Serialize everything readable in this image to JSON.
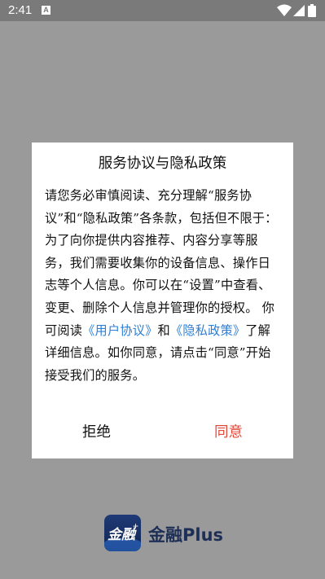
{
  "status_bar": {
    "time": "2:41",
    "notification_icon_letter": "A",
    "icons": [
      "wifi-icon",
      "signal-icon",
      "battery-icon"
    ]
  },
  "dialog": {
    "title": "服务协议与隐私政策",
    "body_intro": "请您务必审慎阅读、充分理解“服务协议”和“隐私政策”各条款，包括但不限于：为了向你提供内容推荐、内容分享等服务，我们需要收集你的设备信息、操作日志等个人信息。你可以在“设置”中查看、变更、删除个人信息并管理你的授权。 你可阅读",
    "link_user_agreement": "《用户协议》",
    "body_and": "和",
    "link_privacy_policy": "《隐私政策》",
    "body_outro": "了解详细信息。如你同意，请点击“同意”开始接受我们的服务。",
    "reject_label": "拒绝",
    "agree_label": "同意"
  },
  "brand": {
    "logo_text": "金融",
    "logo_plus": "+",
    "app_name": "金融Plus"
  },
  "colors": {
    "overlay": "#9a9a9a",
    "link": "#2e7fd6",
    "agree": "#e04a3a",
    "brand_dark": "#1e2f57"
  }
}
